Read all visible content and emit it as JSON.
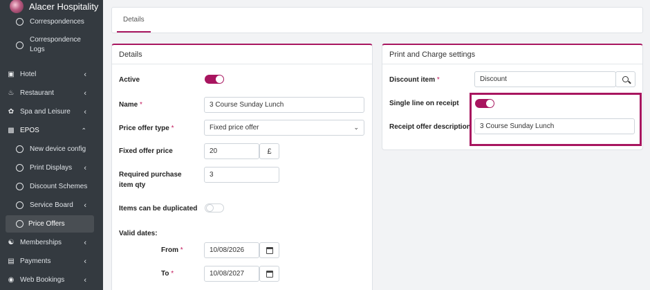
{
  "brand": {
    "name": "Alacer Hospitality"
  },
  "sidebar": {
    "items": [
      {
        "label": "Correspondences",
        "icon": "circle-icon",
        "sub": true
      },
      {
        "label": "Correspondence Logs",
        "icon": "circle-icon",
        "sub": true
      },
      {
        "label": "Hotel",
        "icon": "bed-icon"
      },
      {
        "label": "Restaurant",
        "icon": "utensils-icon"
      },
      {
        "label": "Spa and Leisure",
        "icon": "spa-icon"
      },
      {
        "label": "EPOS",
        "icon": "cash-register-icon",
        "expanded": true
      },
      {
        "label": "New device config",
        "icon": "circle-icon",
        "sub": true
      },
      {
        "label": "Print Displays",
        "icon": "circle-icon",
        "sub": true
      },
      {
        "label": "Discount Schemes",
        "icon": "circle-icon",
        "sub": true
      },
      {
        "label": "Service Board",
        "icon": "circle-icon",
        "sub": true
      },
      {
        "label": "Price Offers",
        "icon": "circle-icon",
        "sub": true,
        "active": true
      },
      {
        "label": "Memberships",
        "icon": "users-icon"
      },
      {
        "label": "Payments",
        "icon": "money-icon"
      },
      {
        "label": "Web Bookings",
        "icon": "globe-icon"
      }
    ]
  },
  "tabs": {
    "details": "Details"
  },
  "details": {
    "title": "Details",
    "active_label": "Active",
    "active": true,
    "name_label": "Name",
    "name_value": "3 Course Sunday Lunch",
    "type_label": "Price offer type",
    "type_value": "Fixed price offer",
    "price_label": "Fixed offer price",
    "price_value": "20",
    "currency": "£",
    "qty_label": "Required purchase item qty",
    "qty_value": "3",
    "dup_label": "Items can be duplicated",
    "duplicated": false,
    "valid_label": "Valid dates:",
    "from_label": "From",
    "from_value": "10/08/2026",
    "to_label": "To",
    "to_value": "10/08/2027",
    "required_mark": "*"
  },
  "print": {
    "title": "Print and Charge settings",
    "discount_label": "Discount item",
    "discount_value": "Discount",
    "single_label": "Single line on receipt",
    "single_line": true,
    "desc_label": "Receipt offer description",
    "desc_value": "3 Course Sunday Lunch"
  },
  "colors": {
    "accent": "#a8155f",
    "sidebar": "#343a40"
  }
}
